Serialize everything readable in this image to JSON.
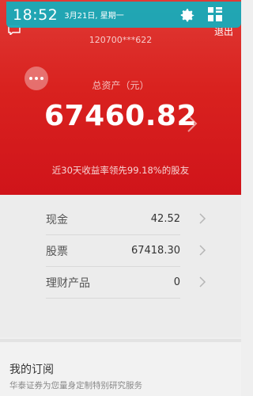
{
  "status_bar": {
    "time": "18:52",
    "date": "3月21日, 星期一",
    "icons": [
      "settings-gear-icon",
      "quick-tiles-icon"
    ],
    "color": "#16acba"
  },
  "header": {
    "back_icon": "chat-bubble-icon",
    "account_number": "120700***622",
    "right_action": "退出"
  },
  "summary": {
    "label": "总资产（元）",
    "total": "67460.82",
    "yield_note": "近30天收益率领先99.18%的股友",
    "accent": "#d9221f"
  },
  "assets": [
    {
      "label": "现金",
      "value": "42.52"
    },
    {
      "label": "股票",
      "value": "67418.30"
    },
    {
      "label": "理财产品",
      "value": "0"
    }
  ],
  "subscription": {
    "title": "我的订阅",
    "description": "华泰证券为您量身定制特别研究服务"
  }
}
